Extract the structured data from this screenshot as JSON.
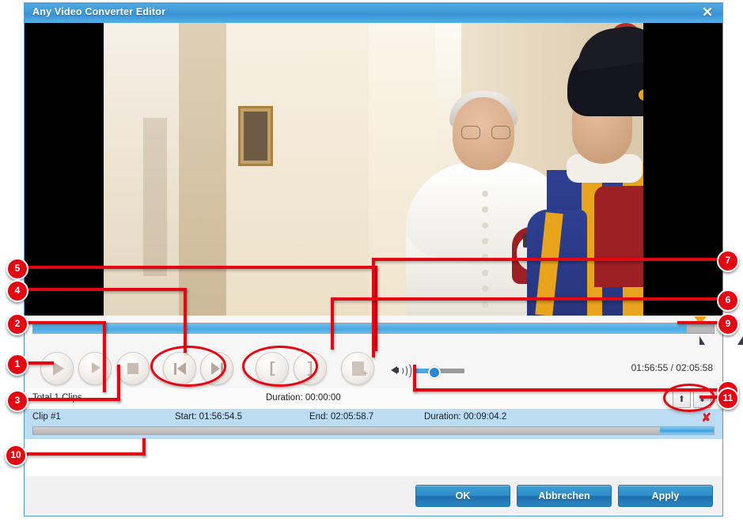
{
  "window": {
    "title": "Any Video Converter Editor",
    "close_label": "✕"
  },
  "preview": {
    "description": "video-preview-frame"
  },
  "transport": {
    "play_label": "▶",
    "play_clip_label": "▶[]",
    "stop_label": "■",
    "prev_label": "|◀",
    "next_label": "▶|",
    "set_start_label": "[",
    "set_end_label": "]",
    "new_clip_label": "+",
    "volume_icon": "speaker-icon",
    "volume_percent": 35,
    "time_display": "01:56:55 / 02:05:58",
    "seek_percent": 96
  },
  "clips_header": {
    "total_label": "Total 1 Clips",
    "duration_label": "Duration: 00:00:00",
    "move_up_label": "⬆",
    "move_down_label": "⬇"
  },
  "clip_row": {
    "name": "Clip #1",
    "start": "Start: 01:56:54.5",
    "end": "End: 02:05:58.7",
    "duration": "Duration: 00:09:04.2",
    "delete_label": "✘"
  },
  "footer": {
    "ok_label": "OK",
    "cancel_label": "Abbrechen",
    "apply_label": "Apply"
  },
  "callouts": [
    {
      "n": "1"
    },
    {
      "n": "2"
    },
    {
      "n": "3"
    },
    {
      "n": "4"
    },
    {
      "n": "5"
    },
    {
      "n": "6"
    },
    {
      "n": "7"
    },
    {
      "n": "8"
    },
    {
      "n": "9"
    },
    {
      "n": "10"
    },
    {
      "n": "11"
    }
  ],
  "colors": {
    "accent": "#3691d3",
    "callout": "#e30613",
    "seek_fill": "#4aa8e4",
    "marker": "#f0a21a",
    "row_selected": "#bcdcf3"
  }
}
